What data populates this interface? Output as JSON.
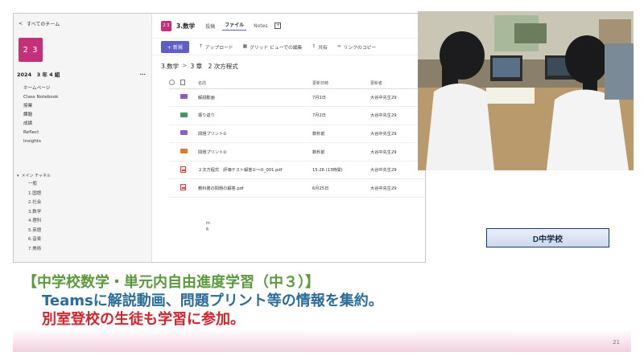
{
  "teams": {
    "back_label": "すべてのチーム",
    "team_avatar": "2 3",
    "team_name": "2024　3 年 4 組",
    "more": "...",
    "nav": [
      "ホームページ",
      "Class Notebook",
      "授業",
      "課題",
      "成績",
      "Reflect",
      "Insights"
    ],
    "channels_header": "メイン チャネル",
    "channels": [
      "一般",
      "1.国語",
      "2.社会",
      "3.数学",
      "4.理科",
      "5.英語",
      "6.音楽",
      "7.美術"
    ],
    "channel_avatar": "2 3",
    "channel_title": "3.数学",
    "tabs": [
      "投稿",
      "ファイル",
      "Notes"
    ],
    "active_tab": "ファイル",
    "tab_add": "+",
    "new_button": "+ 新規",
    "commands": [
      "アップロード",
      "グリッド ビューでの編集",
      "共有",
      "リンクのコピー"
    ],
    "breadcrumb": [
      "3.数学",
      "3 章　2 次方程式"
    ],
    "columns": {
      "name": "名前",
      "modified": "更新日時",
      "modified_by": "更新者"
    },
    "files": [
      {
        "name": "解説動画",
        "modified": "7月1日",
        "by": "大谷中先生29",
        "type": "folder",
        "color": "#8c5fbf"
      },
      {
        "name": "振り返り",
        "modified": "7月2日",
        "by": "大谷中先生29",
        "type": "folder",
        "color": "#3c9a5f"
      },
      {
        "name": "問題プリント①",
        "modified": "数秒前",
        "by": "大谷中先生29",
        "type": "folder",
        "color": "#8c5fbf"
      },
      {
        "name": "問題プリント②",
        "modified": "数秒前",
        "by": "大谷中先生29",
        "type": "folder",
        "color": "#e07a2c"
      },
      {
        "name": "２次方程式　評価テスト解答①〜⑤_001.pdf",
        "modified": "15:26 (13時間)",
        "by": "大谷中先生29",
        "type": "pdf"
      },
      {
        "name": "教科書の問題の解答.pdf",
        "modified": "6月25日",
        "by": "大谷中先生29",
        "type": "pdf"
      }
    ],
    "trailing_text": [
      "m",
      "6"
    ]
  },
  "school_label": "D中学校",
  "caption": {
    "line1": "【中学校数学・単元内自由進度学習（中３）】",
    "line2": "Teamsに解説動画、問題プリント等の情報を集約。",
    "line3": "別室登校の生徒も学習に参加。"
  },
  "page_number": "21"
}
